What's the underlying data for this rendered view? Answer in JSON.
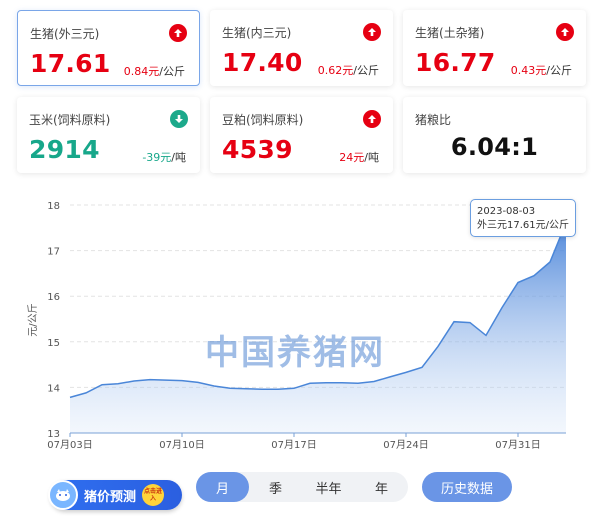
{
  "cards": [
    {
      "name": "生猪(外三元)",
      "value": "17.61",
      "change": "0.84元",
      "unit": "/公斤",
      "trend": "up"
    },
    {
      "name": "生猪(内三元)",
      "value": "17.40",
      "change": "0.62元",
      "unit": "/公斤",
      "trend": "up"
    },
    {
      "name": "生猪(土杂猪)",
      "value": "16.77",
      "change": "0.43元",
      "unit": "/公斤",
      "trend": "up"
    },
    {
      "name": "玉米(饲料原料)",
      "value": "2914",
      "change": "-39元",
      "unit": "/吨",
      "trend": "down"
    },
    {
      "name": "豆粕(饲料原料)",
      "value": "4539",
      "change": "24元",
      "unit": "/吨",
      "trend": "up"
    },
    {
      "name": "猪粮比",
      "value": "6.04:1"
    }
  ],
  "colors": {
    "up": "#e60012",
    "down": "#17a78a",
    "line": "#4a86d8",
    "accent": "#6a95e6"
  },
  "tooltip": {
    "date": "2023-08-03",
    "text": "外三元17.61元/公斤"
  },
  "watermark": "中国养猪网",
  "controls": {
    "predict_label": "猪价预测",
    "predict_badge": "点击进入",
    "ranges": [
      "月",
      "季",
      "半年",
      "年"
    ],
    "active_range": "月",
    "history_label": "历史数据"
  },
  "chart_data": {
    "type": "area",
    "ylabel": "元/公斤",
    "ylim": [
      13,
      18
    ],
    "yticks": [
      13,
      14,
      15,
      16,
      17,
      18
    ],
    "xticks": [
      "07月03日",
      "07月10日",
      "07月17日",
      "07月24日",
      "07月31日"
    ],
    "x": [
      "07-03",
      "07-04",
      "07-05",
      "07-06",
      "07-07",
      "07-08",
      "07-09",
      "07-10",
      "07-11",
      "07-12",
      "07-13",
      "07-14",
      "07-15",
      "07-16",
      "07-17",
      "07-18",
      "07-19",
      "07-20",
      "07-21",
      "07-22",
      "07-23",
      "07-24",
      "07-25",
      "07-26",
      "07-27",
      "07-28",
      "07-29",
      "07-30",
      "07-31",
      "08-01",
      "08-02",
      "08-03"
    ],
    "series": [
      {
        "name": "外三元",
        "values": [
          13.78,
          13.88,
          14.06,
          14.08,
          14.14,
          14.17,
          14.16,
          14.15,
          14.11,
          14.03,
          13.98,
          13.97,
          13.96,
          13.96,
          13.98,
          14.09,
          14.1,
          14.1,
          14.09,
          14.13,
          14.23,
          14.33,
          14.44,
          14.9,
          15.44,
          15.42,
          15.14,
          15.75,
          16.3,
          16.45,
          16.75,
          17.61
        ]
      }
    ],
    "grid": true
  }
}
